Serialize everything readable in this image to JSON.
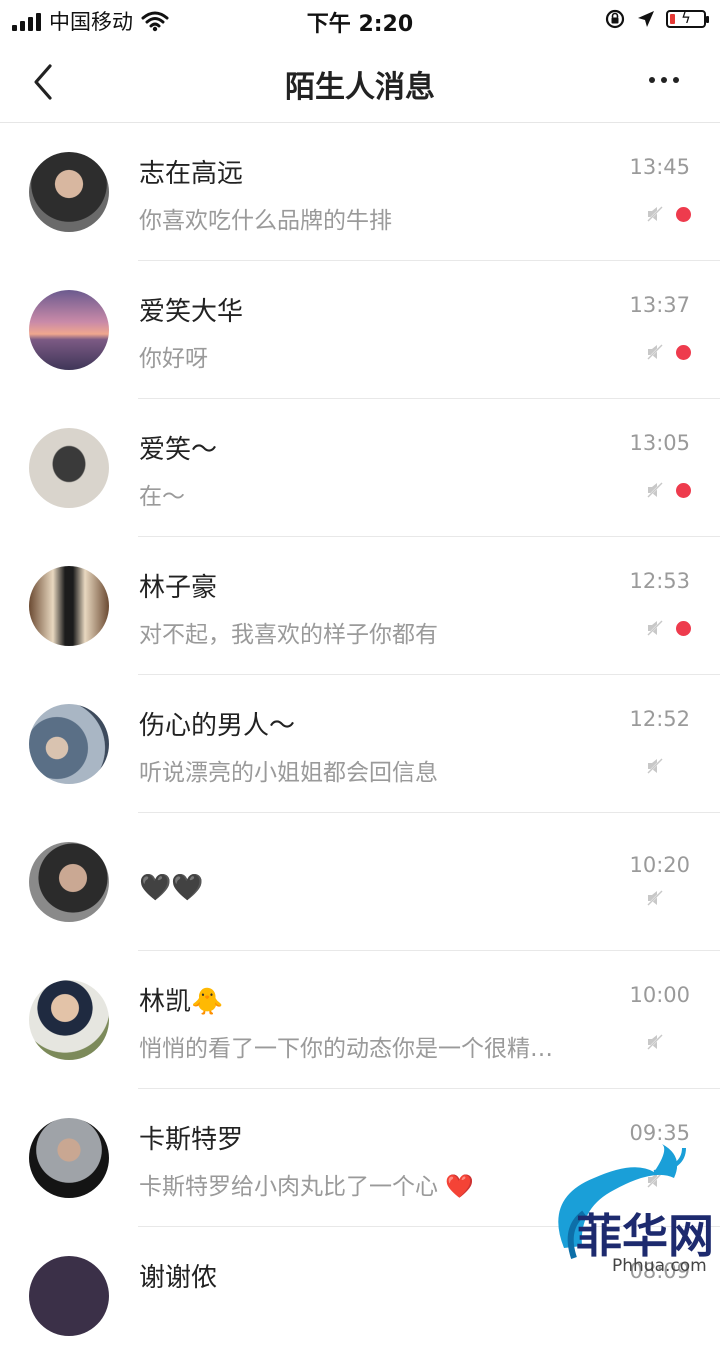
{
  "status_bar": {
    "carrier": "中国移动",
    "time": "下午 2:20"
  },
  "nav": {
    "title": "陌生人消息"
  },
  "conversations": [
    {
      "name": "志在高远",
      "preview": "你喜欢吃什么品牌的牛排",
      "time": "13:45",
      "unread": true,
      "avatar": "man-portrait"
    },
    {
      "name": "爱笑大华",
      "preview": "你好呀",
      "time": "13:37",
      "unread": true,
      "avatar": "sunset-sailboat"
    },
    {
      "name": "爱笑～",
      "preview": "在～",
      "time": "13:05",
      "unread": true,
      "avatar": "sketch-face"
    },
    {
      "name": "林子豪",
      "preview": "对不起，我喜欢的样子你都有",
      "time": "12:53",
      "unread": true,
      "avatar": "man-storefront"
    },
    {
      "name": "伤心的男人～",
      "preview": "听说漂亮的小姐姐都会回信息",
      "time": "12:52",
      "unread": false,
      "avatar": "man-in-car"
    },
    {
      "name": "🖤🖤",
      "preview": "",
      "time": "10:20",
      "unread": false,
      "avatar": "man-selfie"
    },
    {
      "name": "林凯🐥",
      "preview": "悄悄的看了一下你的动态你是一个很精…",
      "time": "10:00",
      "unread": false,
      "avatar": "man-suit"
    },
    {
      "name": "卡斯特罗",
      "preview": "卡斯特罗给小肉丸比了一个心 ❤️",
      "time": "09:35",
      "unread": false,
      "avatar": "man-grey-suit"
    },
    {
      "name": "谢谢侬",
      "preview": "",
      "time": "08:09",
      "unread": false,
      "avatar": "dark-portrait"
    }
  ],
  "watermark": {
    "text": "菲华网",
    "url": "Phhua.com"
  },
  "colors": {
    "unread_dot": "#ee3b4d",
    "secondary_text": "#9a9a9a"
  }
}
